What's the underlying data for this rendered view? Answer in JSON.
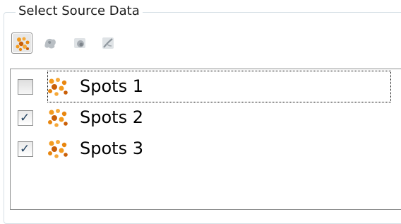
{
  "group": {
    "title": "Select Source Data"
  },
  "toolbar": {
    "buttons": [
      {
        "icon": "spots-icon",
        "active": true
      },
      {
        "icon": "surfaces-icon",
        "active": false
      },
      {
        "icon": "cells-icon",
        "active": false
      },
      {
        "icon": "filaments-icon",
        "active": false
      }
    ]
  },
  "list": {
    "items": [
      {
        "label": "Spots 1",
        "checked": false,
        "icon": "spots-icon"
      },
      {
        "label": "Spots 2",
        "checked": true,
        "icon": "spots-icon"
      },
      {
        "label": "Spots 3",
        "checked": true,
        "icon": "spots-icon"
      }
    ]
  },
  "colors": {
    "spots_orange": "#f39a1d",
    "spots_dark": "#c95f08",
    "checkmark": "#21415f"
  }
}
